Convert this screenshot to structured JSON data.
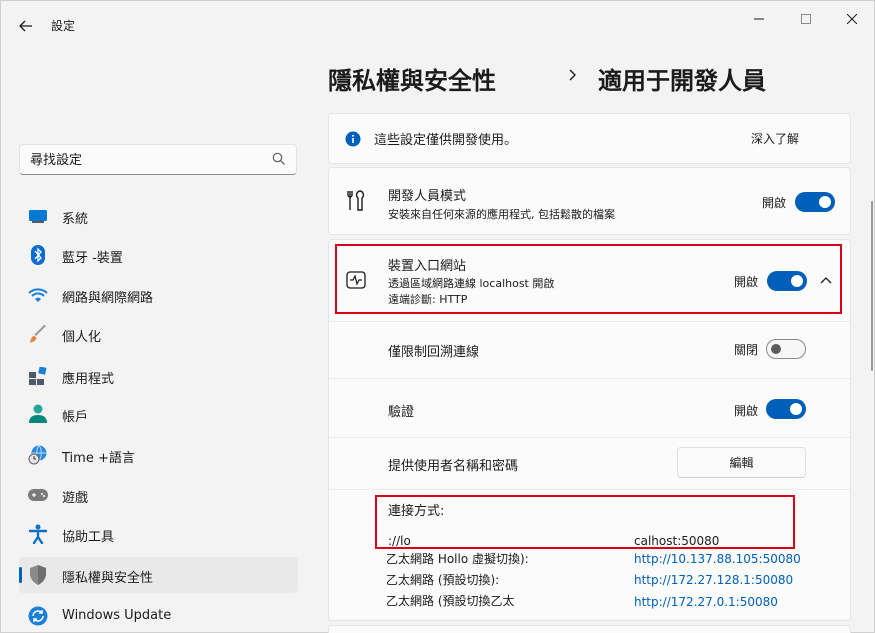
{
  "window": {
    "title": "設定"
  },
  "sidebar": {
    "search_placeholder": "尋找設定",
    "items": [
      {
        "label": "系統",
        "icon": "system-icon"
      },
      {
        "label": "藍牙 -裝置",
        "icon": "bluetooth-icon"
      },
      {
        "label": "網路與網際網路",
        "icon": "wifi-icon"
      },
      {
        "label": "個人化",
        "icon": "brush-icon"
      },
      {
        "label": "應用程式",
        "icon": "apps-icon"
      },
      {
        "label": "帳戶",
        "icon": "account-icon"
      },
      {
        "label": "Time +語言",
        "icon": "time-language-icon"
      },
      {
        "label": "遊戲",
        "icon": "gamepad-icon"
      },
      {
        "label": "協助工具",
        "icon": "accessibility-icon"
      },
      {
        "label": "隱私權與安全性",
        "icon": "shield-icon"
      },
      {
        "label": "Windows Update",
        "icon": "update-icon"
      }
    ],
    "active_index": 9
  },
  "header": {
    "crumb1": "隱私權與安全性",
    "separator": "›",
    "crumb2": "適用于開發人員"
  },
  "info": {
    "text": "這些設定僅供開發使用。",
    "link": "深入了解"
  },
  "dev_mode": {
    "title": "開發人員模式",
    "description": "安裝來自任何來源的應用程式, 包括鬆散的檔案",
    "state_label": "開啟",
    "on": true
  },
  "device_portal": {
    "title": "裝置入口網站",
    "line1": "透過區域網路連線 localhost 開啟",
    "line2": "遠端診斷: HTTP",
    "state_label": "開啟",
    "on": true,
    "restrict_loopback": {
      "label": "僅限制回溯連線",
      "state_label": "關閉",
      "on": false
    },
    "auth": {
      "label": "驗證",
      "state_label": "開啟",
      "on": true
    },
    "credentials": {
      "label": "提供使用者名稱和密碼",
      "button": "編輯"
    },
    "connection": {
      "heading": "連接方式:",
      "rows": [
        {
          "left": "://lo",
          "right": "calhost:50080"
        },
        {
          "left": "乙太網路 Hollo 虛擬切換):",
          "right": "http://10.137.88.105:50080"
        },
        {
          "left": "乙太網路 (預設切換):",
          "right": "http://172.27.128.1:50080"
        },
        {
          "left": "乙太網路 (預設切換乙太",
          "right": "http://172.27.0.1:50080"
        }
      ]
    }
  },
  "colors": {
    "accent": "#005fb8",
    "highlight_box": "#d9001b"
  }
}
